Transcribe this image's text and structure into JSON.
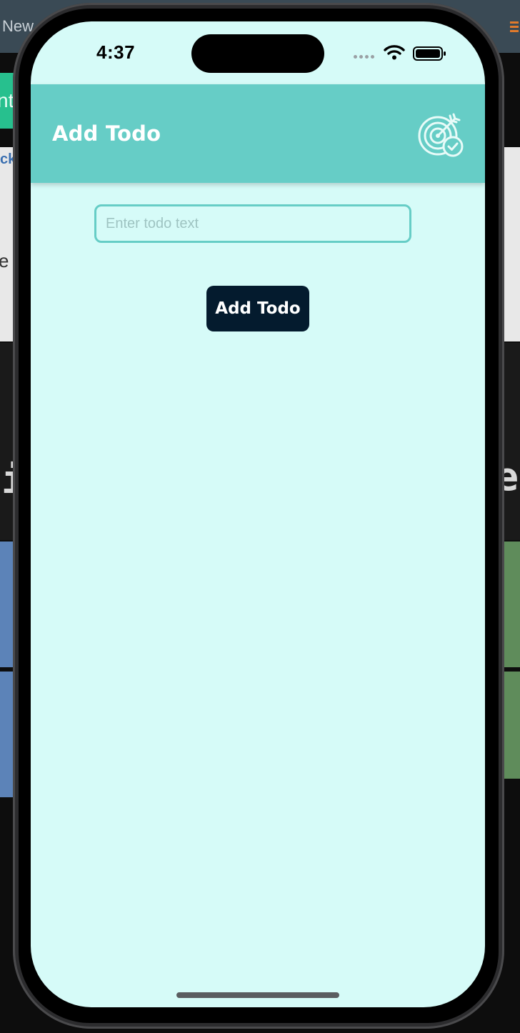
{
  "background": {
    "topbar_text": "New",
    "left_fragment_text": "nt",
    "link_fragment_text": "ck",
    "light_fragment_text": "e",
    "large_letter_left": "i",
    "large_letter_right": "e"
  },
  "status_bar": {
    "time": "4:37"
  },
  "header": {
    "title": "Add Todo",
    "icon": "target-check-icon",
    "background_color": "#66cdc6"
  },
  "form": {
    "input_placeholder": "Enter todo text",
    "input_value": "",
    "button_label": "Add Todo",
    "button_color": "#041b2e"
  },
  "colors": {
    "screen_background": "#d6fbf8",
    "accent": "#66cdc6"
  }
}
